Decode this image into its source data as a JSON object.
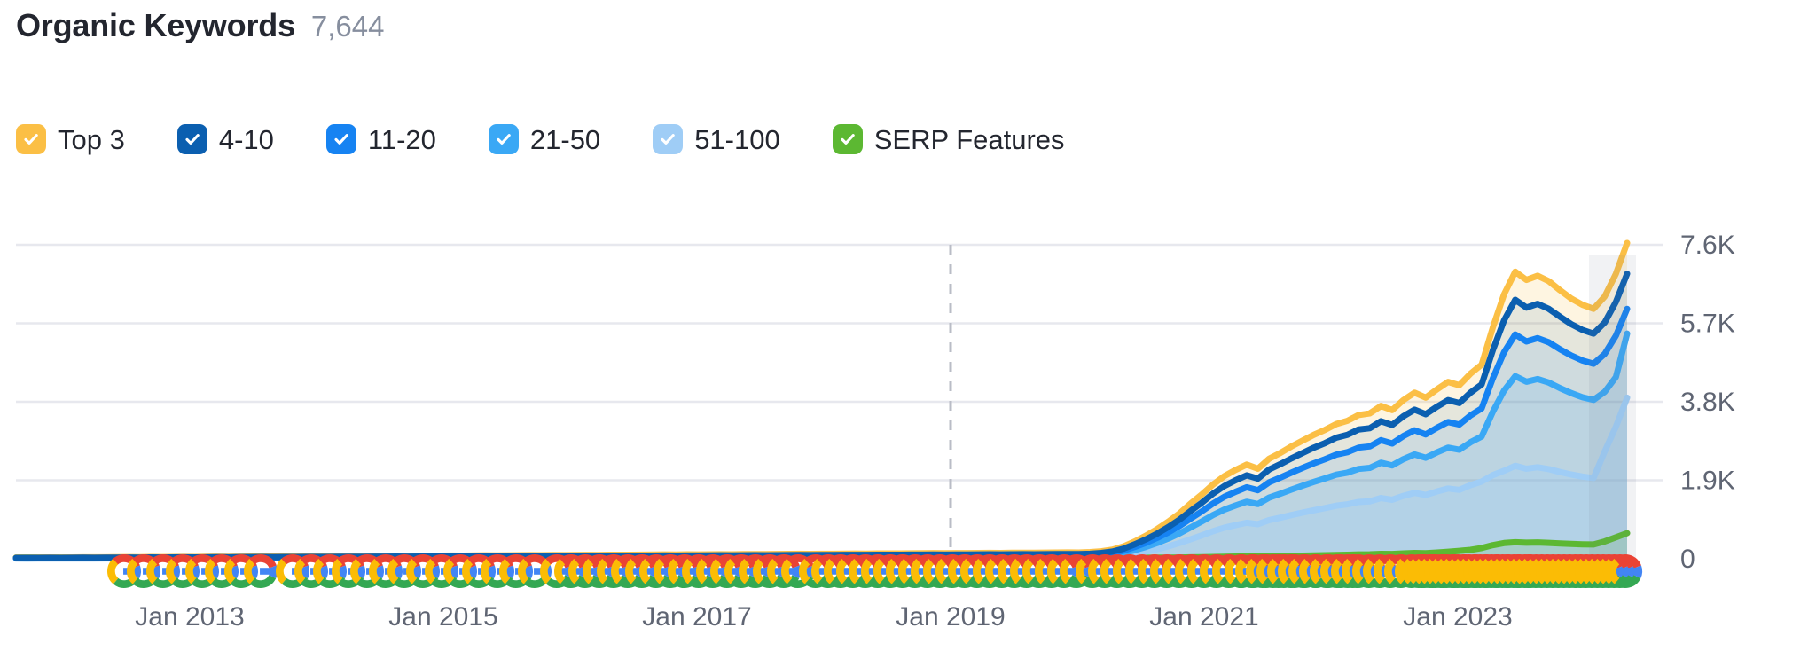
{
  "header": {
    "title": "Organic Keywords",
    "value": "7,644"
  },
  "legend": {
    "items": [
      {
        "label": "Top 3",
        "color": "#fbbf45",
        "checked": true,
        "name": "legend-top-3"
      },
      {
        "label": "4-10",
        "color": "#0b5fb0",
        "checked": true,
        "name": "legend-4-10"
      },
      {
        "label": "11-20",
        "color": "#1683f2",
        "checked": true,
        "name": "legend-11-20"
      },
      {
        "label": "21-50",
        "color": "#3aa8f5",
        "checked": true,
        "name": "legend-21-50"
      },
      {
        "label": "51-100",
        "color": "#9fcdf6",
        "checked": true,
        "name": "legend-51-100"
      },
      {
        "label": "SERP Features",
        "color": "#5cb832",
        "checked": true,
        "name": "legend-serp-features"
      }
    ]
  },
  "chart_data": {
    "type": "area",
    "title": "Organic Keywords",
    "xlabel": "",
    "ylabel": "",
    "grid": true,
    "legend_position": "top",
    "yticks": [
      "0",
      "1.9K",
      "3.8K",
      "5.7K",
      "7.6K"
    ],
    "ytick_values": [
      0,
      1900,
      3800,
      5700,
      7600
    ],
    "ylim": [
      0,
      7900
    ],
    "xticks": [
      "Jan 2013",
      "Jan 2015",
      "Jan 2017",
      "Jan 2019",
      "Jan 2021",
      "Jan 2023"
    ],
    "xlim": [
      "2012-01",
      "2024-05"
    ],
    "annotations": {
      "vertical_dashed_line": "Jan 2019",
      "right_shaded_band": "forecast / incomplete period",
      "baseline_markers": "Google algorithm update markers (G logo icons)"
    },
    "series": [
      {
        "name": "Top 3",
        "color": "#fbbf45",
        "values": [
          30,
          28,
          30,
          32,
          30,
          33,
          35,
          34,
          36,
          38,
          40,
          38,
          42,
          40,
          44,
          46,
          44,
          48,
          50,
          48,
          52,
          54,
          56,
          54,
          58,
          56,
          60,
          62,
          60,
          64,
          66,
          64,
          68,
          70,
          72,
          70,
          74,
          72,
          76,
          78,
          76,
          80,
          82,
          80,
          84,
          86,
          88,
          86,
          90,
          88,
          92,
          94,
          92,
          96,
          98,
          96,
          100,
          102,
          104,
          102,
          106,
          104,
          108,
          110,
          108,
          112,
          114,
          112,
          116,
          118,
          120,
          118,
          122,
          120,
          124,
          126,
          124,
          128,
          130,
          128,
          132,
          134,
          136,
          134,
          138,
          136,
          140,
          142,
          140,
          144,
          146,
          144,
          148,
          150,
          152,
          150,
          160,
          180,
          220,
          300,
          420,
          560,
          720,
          900,
          1100,
          1340,
          1560,
          1800,
          2000,
          2150,
          2280,
          2180,
          2420,
          2560,
          2720,
          2860,
          3000,
          3120,
          3260,
          3340,
          3480,
          3520,
          3700,
          3600,
          3840,
          4020,
          3900,
          4100,
          4280,
          4200,
          4480,
          4700,
          5600,
          6400,
          6950,
          6750,
          6850,
          6720,
          6500,
          6300,
          6150,
          6050,
          6350,
          6900,
          7644
        ]
      },
      {
        "name": "4-10",
        "color": "#0b5fb0",
        "values": [
          22,
          21,
          22,
          24,
          22,
          25,
          26,
          25,
          27,
          28,
          30,
          28,
          31,
          30,
          33,
          34,
          33,
          36,
          37,
          36,
          39,
          40,
          42,
          40,
          43,
          42,
          45,
          46,
          45,
          48,
          49,
          48,
          51,
          52,
          54,
          52,
          55,
          54,
          57,
          58,
          57,
          60,
          61,
          60,
          63,
          64,
          66,
          64,
          67,
          66,
          69,
          70,
          69,
          72,
          73,
          72,
          75,
          76,
          78,
          76,
          79,
          78,
          81,
          82,
          81,
          84,
          85,
          84,
          87,
          88,
          90,
          88,
          91,
          90,
          93,
          94,
          93,
          96,
          97,
          96,
          99,
          100,
          102,
          100,
          103,
          102,
          105,
          106,
          105,
          108,
          109,
          108,
          111,
          112,
          114,
          112,
          120,
          140,
          175,
          245,
          350,
          470,
          610,
          770,
          950,
          1160,
          1360,
          1580,
          1760,
          1900,
          2020,
          1940,
          2160,
          2290,
          2430,
          2560,
          2690,
          2800,
          2930,
          3000,
          3130,
          3160,
          3330,
          3240,
          3450,
          3610,
          3500,
          3680,
          3840,
          3770,
          4020,
          4220,
          5050,
          5770,
          6270,
          6080,
          6170,
          6050,
          5860,
          5680,
          5540,
          5450,
          5720,
          6220,
          6900
        ]
      },
      {
        "name": "11-20",
        "color": "#1683f2",
        "values": [
          16,
          15,
          16,
          18,
          16,
          18,
          19,
          18,
          20,
          21,
          22,
          21,
          23,
          22,
          24,
          25,
          24,
          26,
          27,
          26,
          29,
          30,
          31,
          30,
          32,
          31,
          33,
          34,
          33,
          35,
          36,
          35,
          38,
          39,
          40,
          39,
          41,
          40,
          42,
          43,
          42,
          44,
          45,
          44,
          47,
          48,
          49,
          48,
          50,
          49,
          51,
          52,
          51,
          53,
          54,
          53,
          56,
          57,
          58,
          57,
          59,
          58,
          60,
          61,
          60,
          62,
          63,
          62,
          65,
          66,
          67,
          66,
          68,
          67,
          69,
          70,
          69,
          71,
          72,
          71,
          74,
          75,
          76,
          75,
          77,
          76,
          78,
          79,
          78,
          80,
          81,
          80,
          83,
          84,
          85,
          84,
          92,
          108,
          138,
          195,
          285,
          385,
          505,
          640,
          795,
          975,
          1150,
          1340,
          1500,
          1620,
          1730,
          1660,
          1850,
          1965,
          2085,
          2200,
          2310,
          2410,
          2520,
          2580,
          2690,
          2720,
          2870,
          2790,
          2970,
          3110,
          3010,
          3170,
          3310,
          3250,
          3470,
          3640,
          4370,
          5000,
          5430,
          5260,
          5340,
          5240,
          5070,
          4920,
          4800,
          4720,
          4960,
          5400,
          6050
        ]
      },
      {
        "name": "21-50",
        "color": "#3aa8f5",
        "values": [
          10,
          9,
          10,
          11,
          10,
          11,
          12,
          11,
          13,
          13,
          14,
          13,
          15,
          14,
          15,
          16,
          15,
          17,
          17,
          16,
          18,
          19,
          20,
          19,
          20,
          19,
          21,
          22,
          21,
          22,
          23,
          22,
          24,
          25,
          26,
          25,
          26,
          25,
          27,
          28,
          27,
          28,
          29,
          28,
          30,
          31,
          32,
          31,
          32,
          31,
          33,
          34,
          33,
          34,
          35,
          34,
          36,
          37,
          38,
          37,
          38,
          37,
          39,
          40,
          39,
          40,
          41,
          40,
          42,
          43,
          44,
          43,
          44,
          43,
          45,
          46,
          45,
          46,
          47,
          46,
          48,
          49,
          50,
          49,
          50,
          49,
          51,
          52,
          51,
          52,
          53,
          52,
          54,
          55,
          56,
          55,
          62,
          74,
          96,
          140,
          208,
          288,
          382,
          490,
          615,
          760,
          905,
          1060,
          1190,
          1290,
          1380,
          1325,
          1480,
          1575,
          1675,
          1770,
          1860,
          1945,
          2035,
          2085,
          2175,
          2200,
          2325,
          2260,
          2410,
          2525,
          2445,
          2575,
          2690,
          2640,
          2820,
          2960,
          3560,
          4070,
          4420,
          4285,
          4350,
          4265,
          4130,
          4010,
          3910,
          3845,
          4040,
          4400,
          5450
        ]
      },
      {
        "name": "51-100",
        "color": "#9fcdf6",
        "values": [
          5,
          5,
          5,
          6,
          5,
          6,
          6,
          6,
          7,
          7,
          7,
          7,
          8,
          7,
          8,
          8,
          8,
          9,
          9,
          8,
          9,
          10,
          10,
          10,
          10,
          10,
          11,
          11,
          11,
          11,
          12,
          11,
          12,
          13,
          13,
          13,
          13,
          13,
          14,
          14,
          14,
          14,
          15,
          14,
          15,
          16,
          16,
          16,
          16,
          16,
          17,
          17,
          17,
          17,
          18,
          17,
          18,
          19,
          19,
          19,
          19,
          19,
          20,
          20,
          20,
          20,
          21,
          20,
          21,
          22,
          22,
          22,
          22,
          22,
          23,
          23,
          23,
          23,
          24,
          23,
          24,
          25,
          25,
          25,
          25,
          25,
          26,
          26,
          26,
          26,
          27,
          26,
          27,
          28,
          28,
          28,
          32,
          40,
          54,
          80,
          122,
          172,
          232,
          300,
          382,
          475,
          568,
          668,
          752,
          815,
          872,
          838,
          935,
          995,
          1058,
          1118,
          1175,
          1228,
          1285,
          1318,
          1375,
          1390,
          1470,
          1428,
          1522,
          1595,
          1545,
          1628,
          1700,
          1668,
          1782,
          1870,
          2025,
          2130,
          2250,
          2180,
          2215,
          2170,
          2100,
          2040,
          1990,
          1955,
          2600,
          3200,
          3900
        ]
      },
      {
        "name": "SERP Features",
        "color": "#5cb832",
        "values": [
          30,
          30,
          30,
          30,
          30,
          30,
          30,
          30,
          30,
          30,
          30,
          30,
          28,
          28,
          26,
          26,
          26,
          26,
          24,
          24,
          24,
          24,
          24,
          24,
          22,
          22,
          22,
          22,
          22,
          22,
          22,
          22,
          22,
          22,
          22,
          22,
          20,
          20,
          20,
          20,
          20,
          20,
          20,
          20,
          20,
          20,
          20,
          20,
          20,
          20,
          20,
          20,
          20,
          20,
          20,
          20,
          20,
          20,
          20,
          20,
          20,
          20,
          20,
          20,
          20,
          20,
          20,
          20,
          20,
          20,
          20,
          20,
          20,
          20,
          20,
          20,
          20,
          20,
          20,
          20,
          20,
          20,
          20,
          20,
          20,
          20,
          20,
          20,
          20,
          20,
          20,
          20,
          20,
          20,
          20,
          20,
          20,
          20,
          20,
          20,
          22,
          24,
          26,
          28,
          30,
          34,
          38,
          42,
          48,
          54,
          58,
          56,
          62,
          66,
          70,
          74,
          80,
          86,
          92,
          96,
          104,
          108,
          118,
          115,
          128,
          140,
          135,
          150,
          170,
          190,
          215,
          260,
          330,
          380,
          400,
          390,
          395,
          385,
          370,
          360,
          350,
          345,
          420,
          520,
          620
        ]
      }
    ]
  }
}
